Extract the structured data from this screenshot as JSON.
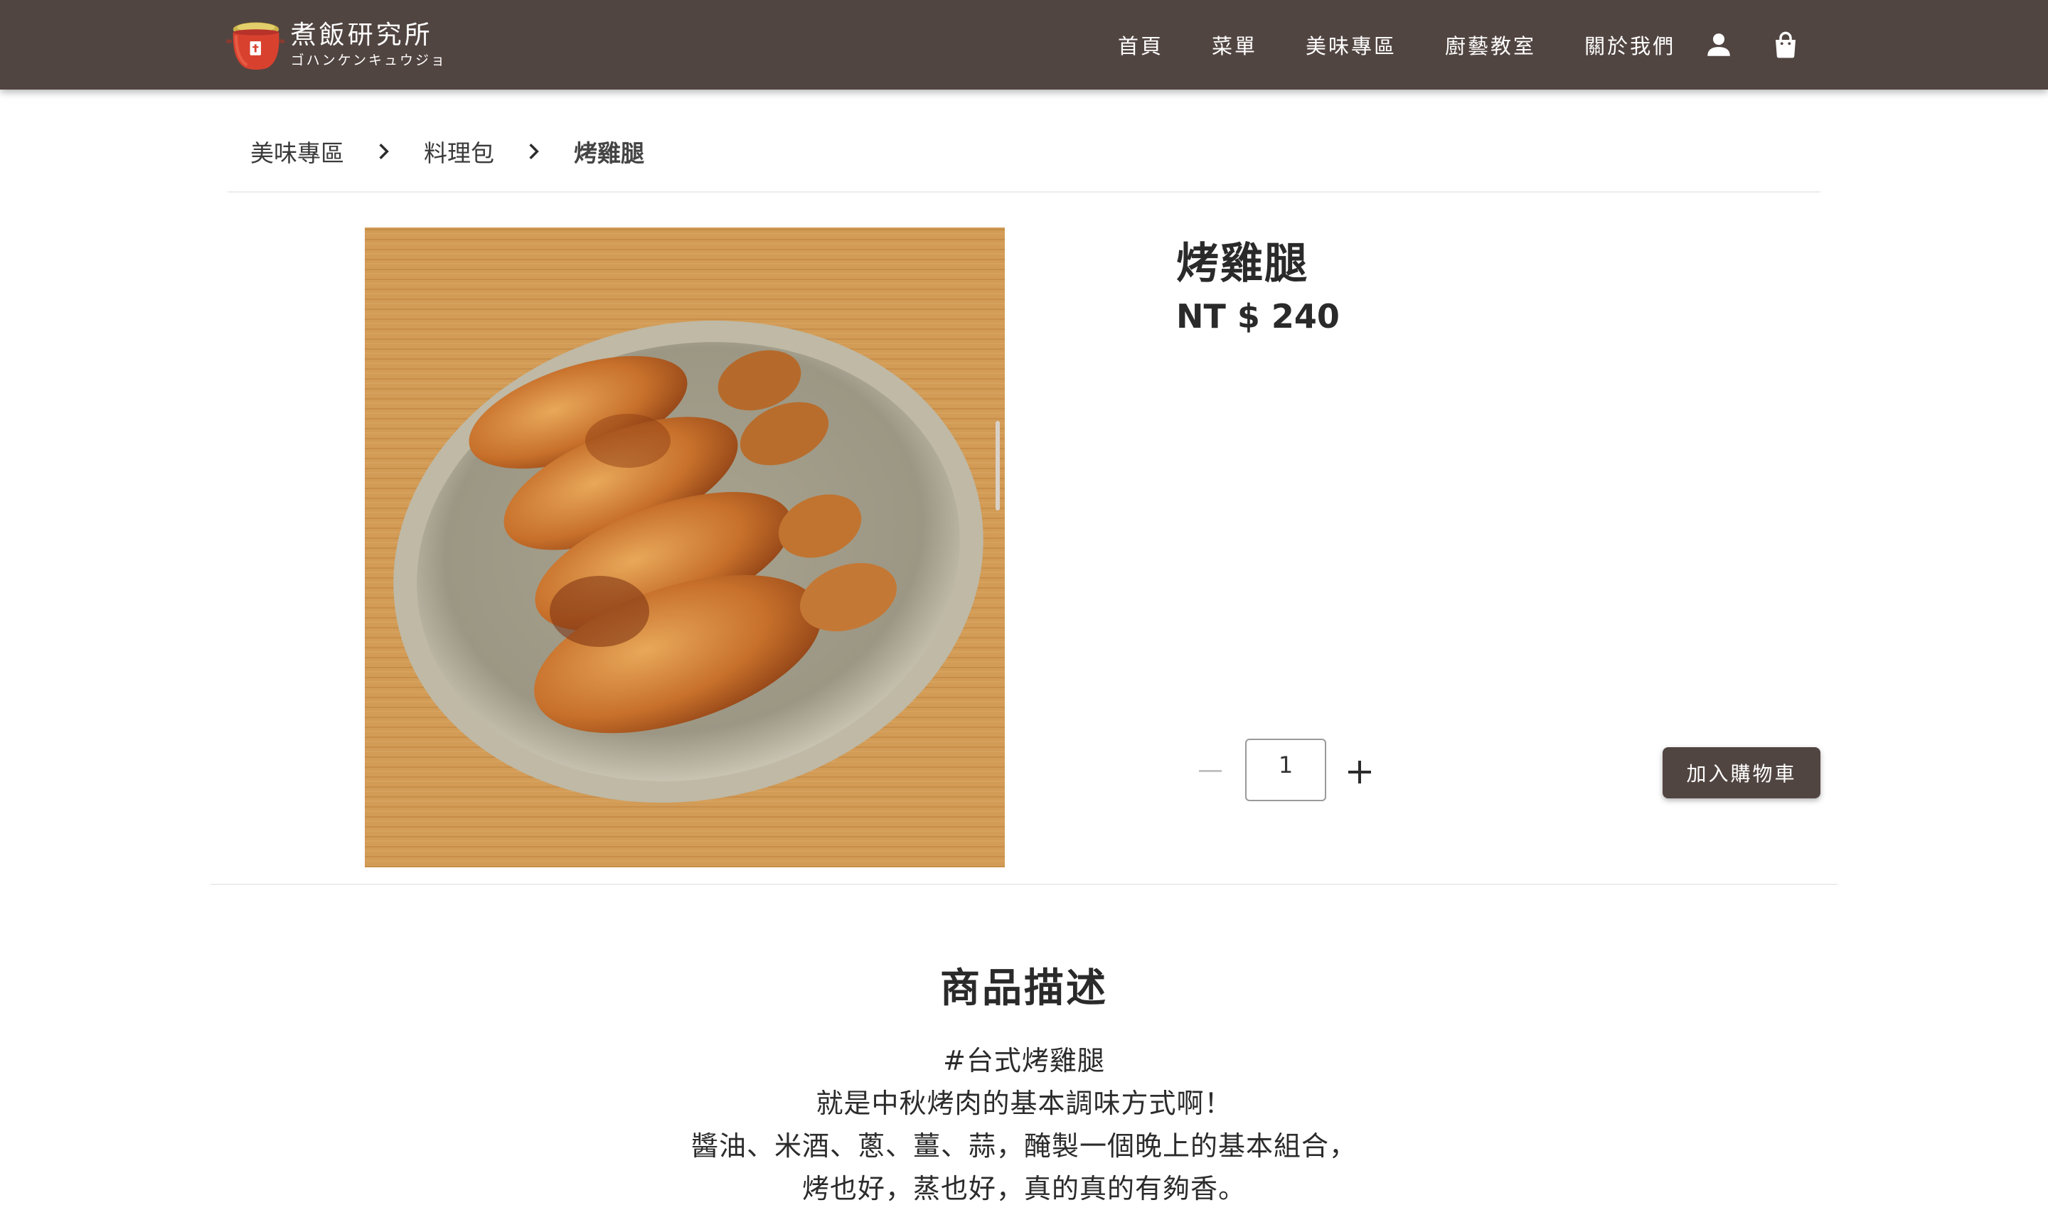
{
  "brand": {
    "name": "煮飯研究所",
    "tagline": "ゴハンケンキュウジョ"
  },
  "nav": {
    "items": [
      {
        "label": "首頁"
      },
      {
        "label": "菜單"
      },
      {
        "label": "美味專區"
      },
      {
        "label": "廚藝教室"
      },
      {
        "label": "關於我們"
      }
    ],
    "icons": [
      "user-icon",
      "shopping-bag-icon"
    ]
  },
  "breadcrumb": {
    "items": [
      "美味專區",
      "料理包",
      "烤雞腿"
    ],
    "separator_icon": "chevron-right-icon"
  },
  "product": {
    "title": "烤雞腿",
    "price": "NT $ 240",
    "image_subject": "roasted chicken drumsticks on a grey plate over a wooden table",
    "quantity": "1",
    "add_to_cart_label": "加入購物車"
  },
  "description": {
    "heading": "商品描述",
    "lines": [
      "#台式烤雞腿",
      "就是中秋烤肉的基本調味方式啊！",
      "醬油、米酒、蔥、薑、蒜，醃製一個晚上的基本組合，",
      "烤也好，蒸也好，真的真的有夠香。"
    ]
  },
  "colors": {
    "header_bg": "#514541",
    "button_bg": "#514541",
    "text": "#2b2b2b",
    "divider": "#ececec"
  }
}
